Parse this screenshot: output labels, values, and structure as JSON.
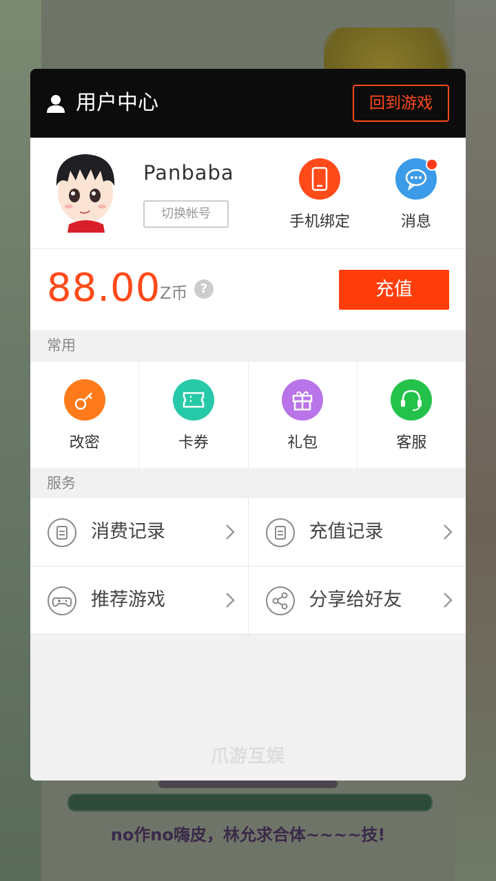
{
  "header": {
    "title": "用户中心",
    "back_button": "回到游戏"
  },
  "profile": {
    "username": "Panbaba",
    "switch_account": "切换帐号",
    "quick_actions": [
      {
        "label": "手机绑定",
        "icon": "phone-icon",
        "color": "#ff4a1a"
      },
      {
        "label": "消息",
        "icon": "chat-icon",
        "color": "#3b9be8",
        "has_badge": true
      }
    ]
  },
  "balance": {
    "amount": "88.00",
    "unit": "Z币",
    "help": "?",
    "recharge_button": "充值"
  },
  "common": {
    "section_label": "常用",
    "items": [
      {
        "label": "改密",
        "icon": "key-icon",
        "color": "#ff7a1a"
      },
      {
        "label": "卡券",
        "icon": "ticket-icon",
        "color": "#26c9a8"
      },
      {
        "label": "礼包",
        "icon": "gift-icon",
        "color": "#b874e8"
      },
      {
        "label": "客服",
        "icon": "headset-icon",
        "color": "#24c24a"
      }
    ]
  },
  "services": {
    "section_label": "服务",
    "items": [
      {
        "label": "消费记录",
        "icon": "clipboard-icon"
      },
      {
        "label": "充值记录",
        "icon": "clipboard-icon"
      },
      {
        "label": "推荐游戏",
        "icon": "gamepad-icon"
      },
      {
        "label": "分享给好友",
        "icon": "share-icon"
      }
    ]
  },
  "footer": {
    "brand": "爪游互娱"
  },
  "background": {
    "caption": "no作no嗨皮，林允求合体~~~~技!"
  },
  "colors": {
    "accent": "#ff4a1a",
    "header_bg": "#0c0c0c"
  }
}
